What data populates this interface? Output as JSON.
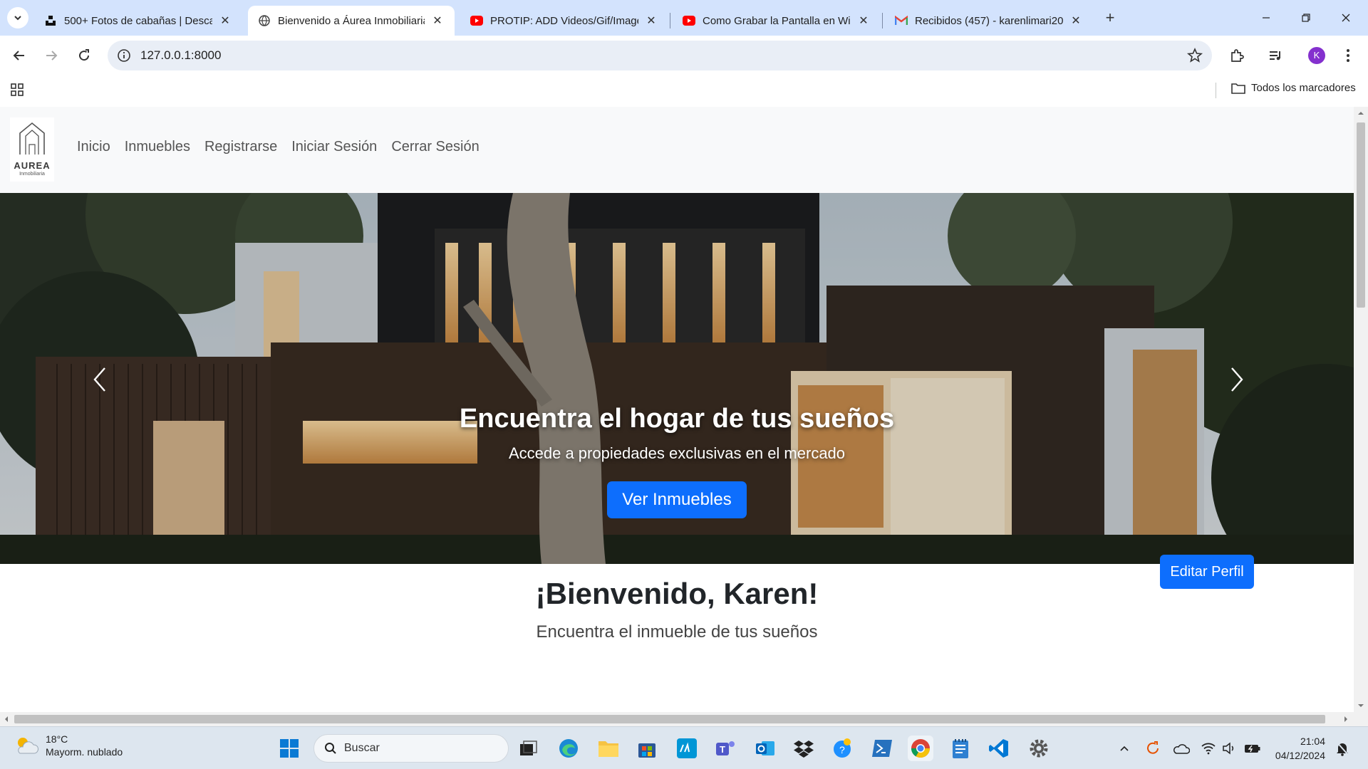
{
  "browser": {
    "tabs": [
      {
        "title": "500+ Fotos de cabañas | Descar",
        "favicon": "unsplash-icon",
        "active": false
      },
      {
        "title": "Bienvenido a Áurea Inmobiliaria",
        "favicon": "globe-icon",
        "active": true
      },
      {
        "title": "PROTIP: ADD Videos/Gif/Image",
        "favicon": "youtube-icon",
        "active": false
      },
      {
        "title": "Como Grabar la Pantalla en Win",
        "favicon": "youtube-icon",
        "active": false
      },
      {
        "title": "Recibidos (457) - karenlimari20",
        "favicon": "gmail-icon",
        "active": false
      }
    ],
    "url": "127.0.0.1:8000",
    "profile_initial": "K",
    "bookmarks_all": "Todos los marcadores"
  },
  "site": {
    "logo": {
      "word": "AUREA",
      "sub": "Inmobiliaria"
    },
    "nav": [
      "Inicio",
      "Inmuebles",
      "Registrarse",
      "Iniciar Sesión",
      "Cerrar Sesión"
    ],
    "hero": {
      "title": "Encuentra el hogar de tus sueños",
      "subtitle": "Accede a propiedades exclusivas en el mercado",
      "button": "Ver Inmuebles"
    },
    "welcome": {
      "title": "¡Bienvenido, Karen!",
      "subtitle": "Encuentra el inmueble de tus sueños"
    },
    "edit_profile": "Editar Perfil"
  },
  "taskbar": {
    "weather": {
      "temp": "18°C",
      "desc": "Mayorm. nublado"
    },
    "search_placeholder": "Buscar",
    "time": "21:04",
    "date": "04/12/2024"
  },
  "colors": {
    "tabstrip": "#d3e3fd",
    "primary_button": "#0d6efd",
    "navbar_bg": "#f8f9fa"
  }
}
